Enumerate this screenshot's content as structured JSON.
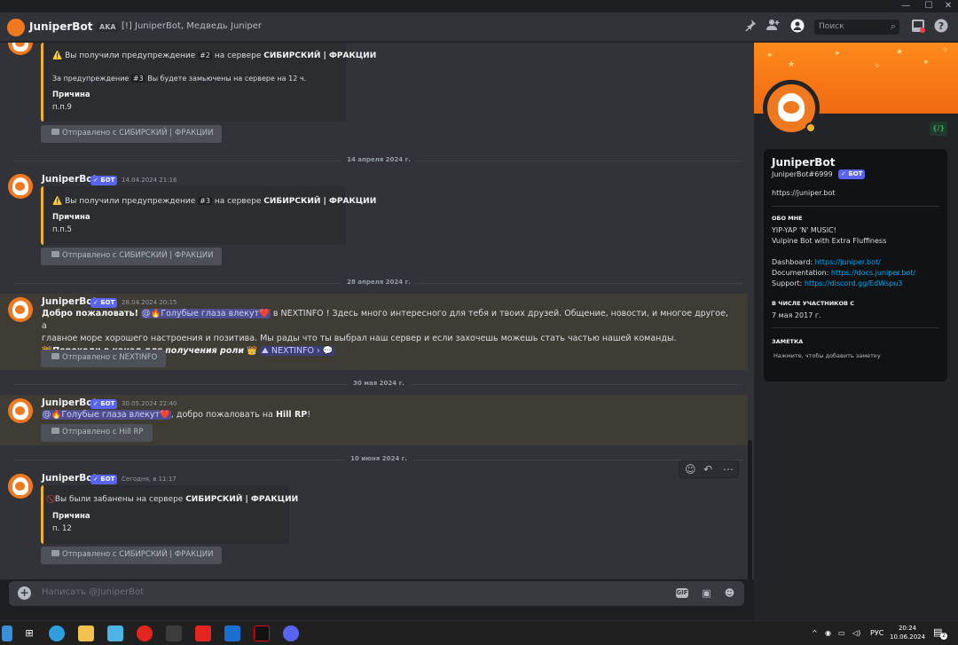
{
  "window": {
    "minimize": "—",
    "maximize": "☐",
    "close": "✕"
  },
  "topbar": {
    "title": "JuniperBot",
    "aka_label": "AKA",
    "aka_names": "[!] JuniperBot, Медведь Juniper",
    "search_placeholder": "Поиск",
    "icons": [
      "pin-icon",
      "add-friend-icon",
      "user-profile-icon",
      "inbox-icon",
      "help-icon"
    ]
  },
  "messages": [
    {
      "embed_line1_pre": "Вы получили предупреждение",
      "embed_line1_code": "#2",
      "embed_line1_mid": "на сервере",
      "embed_line1_server": "СИБИРСКИЙ | ФРАКЦИИ",
      "embed_sub_pre": "За предупреждение",
      "embed_sub_code": "#3",
      "embed_sub_post": "Вы будете замьючены на сервере на 12 ч.",
      "field_name": "Причина",
      "field_value": "п.п.9",
      "sent_from": "Отправлено с СИБИРСКИЙ | ФРАКЦИИ"
    },
    {
      "date_divider": "14 апреля 2024 г.",
      "author": "JuniperBot",
      "badge": "БОТ",
      "timestamp": "14.04.2024 21:16",
      "embed_line1_pre": "Вы получили предупреждение",
      "embed_line1_code": "#3",
      "embed_line1_mid": "на сервере",
      "embed_line1_server": "СИБИРСКИЙ | ФРАКЦИИ",
      "field_name": "Причина",
      "field_value": "п.п.5",
      "sent_from": "Отправлено с СИБИРСКИЙ | ФРАКЦИИ"
    },
    {
      "date_divider": "28 апреля 2024 г.",
      "author": "JuniperBot",
      "badge": "БОТ",
      "timestamp": "28.04.2024 20:15",
      "welcome": "Добро пожаловать!",
      "mention": "@🔥Голубые глаза влекут❤️",
      "text1": "в",
      "server_name": "NEXTINFO",
      "text2": "! Здесь много интересного для тебя и твоих друзей. Общение, новости, и многое другое, а",
      "line2": "главное море хорошего настроения и позитива.  Мы рады что ты выбрал наш сервер и если захочешь можешь  стать частью нашей команды.",
      "line3_bold": "Переходи в канал для получения роли",
      "channel": "NEXTINFO",
      "sent_from": "Отправлено с NEXTINFO"
    },
    {
      "date_divider": "30 мая 2024 г.",
      "author": "JuniperBot",
      "badge": "БОТ",
      "timestamp": "30.05.2024 22:40",
      "mention": "@🔥Голубые глаза влекут❤️",
      "text": ", добро пожаловать на",
      "server": "Hill RP",
      "sent_from": "Отправлено с Hill RP"
    },
    {
      "date_divider": "10 июня 2024 г.",
      "author": "JuniperBot",
      "badge": "БОТ",
      "timestamp": "Сегодня, в 11:17",
      "embed_line1_pre": "Вы были забанены на сервере",
      "embed_line1_server": "СИБИРСКИЙ | ФРАКЦИИ",
      "field_name": "Причина",
      "field_value": "п. 12",
      "sent_from": "Отправлено с СИБИРСКИЙ | ФРАКЦИИ"
    }
  ],
  "composer": {
    "placeholder": "Написать @JuniperBot",
    "gif": "GIF"
  },
  "profile": {
    "display_name": "JuniperBot",
    "username": "JuniperBot#6999",
    "badge": "БОТ",
    "website": "https://juniper.bot",
    "about_header": "ОБО МНЕ",
    "about_line1": "YIP-YAP 'N' MUSIC!",
    "about_line2": "Vulpine Bot with Extra Fluffiness",
    "dashboard_label": "Dashboard:",
    "dashboard_url": "https://juniper.bot/",
    "docs_label": "Documentation:",
    "docs_url": "https://docs.juniper.bot/",
    "support_label": "Support:",
    "support_url": "https://discord.gg/EdWspu3",
    "member_header": "В ЧИСЛЕ УЧАСТНИКОВ С",
    "member_since": "7 мая 2017 г.",
    "note_header": "ЗАМЕТКА",
    "note_placeholder": "Нажмите, чтобы добавить заметку",
    "dev_badge": "{/}"
  },
  "taskbar": {
    "lang": "РУС",
    "time": "20:24",
    "date": "10.06.2024",
    "notif_count": "2"
  },
  "colors": {
    "accent": "#5865f2",
    "embed_border": "#f0b232",
    "banner": "#f0781e",
    "link": "#00a8fc"
  }
}
